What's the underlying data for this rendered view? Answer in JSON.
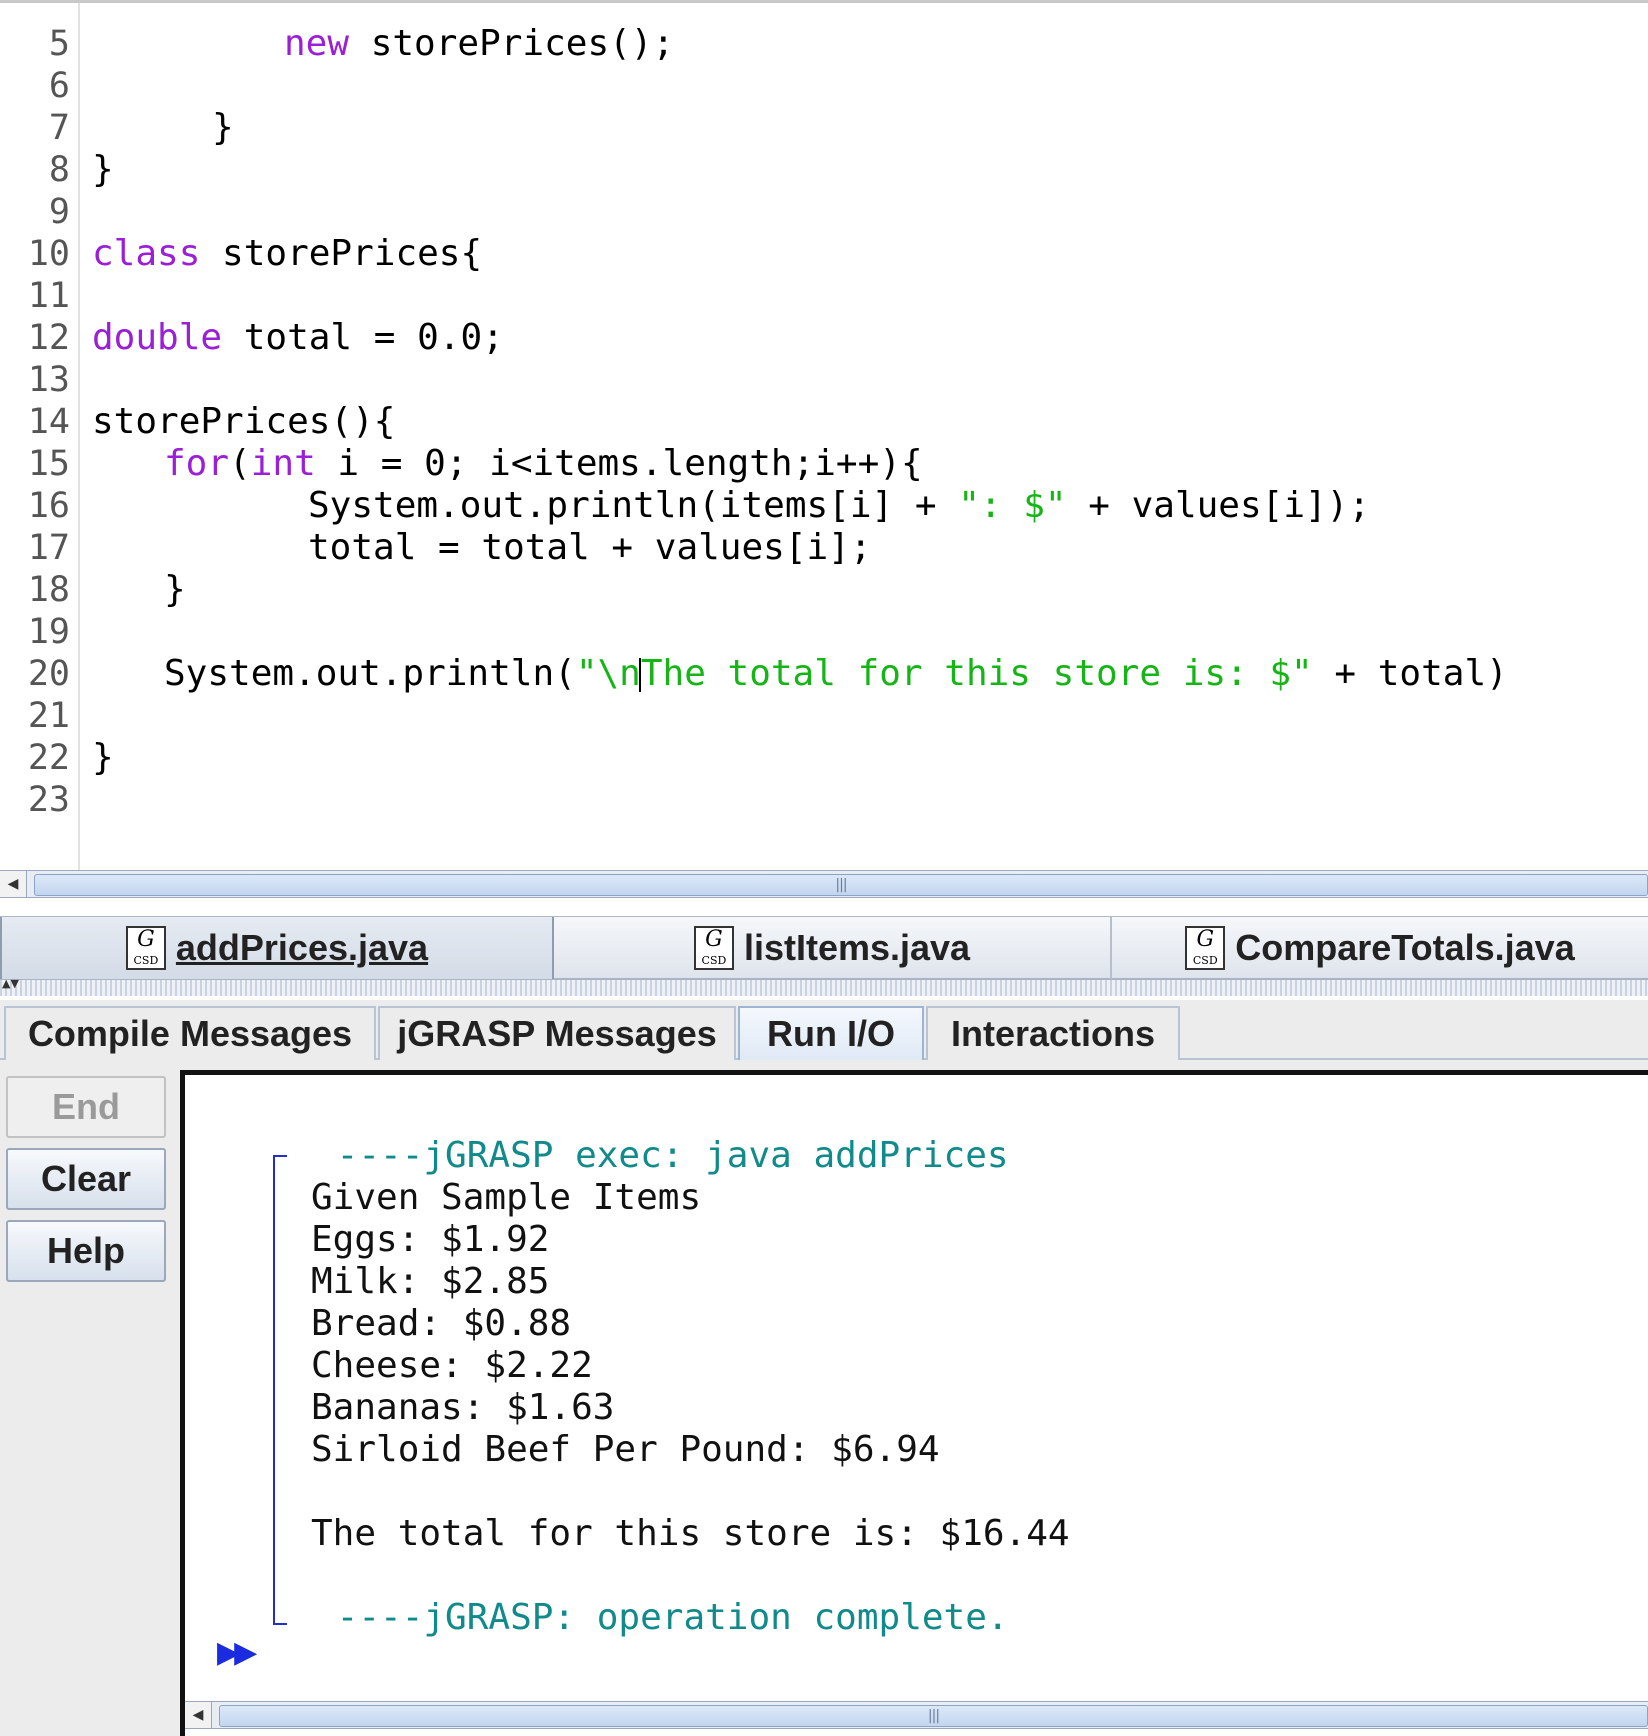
{
  "editor": {
    "line_numbers": [
      "5",
      "6",
      "7",
      "8",
      "9",
      "10",
      "11",
      "12",
      "13",
      "14",
      "15",
      "16",
      "17",
      "18",
      "19",
      "20",
      "21",
      "22",
      "23"
    ],
    "code": {
      "l5_kw": "new",
      "l5_rest": " storePrices();",
      "l7": "}",
      "l8": "}",
      "l10_kw": "class",
      "l10_rest": " storePrices{",
      "l12_kw": "double",
      "l12_rest": " total = 0.0;",
      "l14": "storePrices(){",
      "l15_kw1": "for",
      "l15_p": "(",
      "l15_kw2": "int",
      "l15_rest": " i = 0; i<items.length;i++){",
      "l16_a": "System.out.println(items[i] + ",
      "l16_str": "\": $\"",
      "l16_b": " + values[i]);",
      "l17": "total = total + values[i];",
      "l18": "}",
      "l20_a": "System.out.println(",
      "l20_str1": "\"\\n",
      "l20_str2": "The total for this store is: $\"",
      "l20_b": " + total)",
      "l22": "}"
    }
  },
  "file_tabs": [
    {
      "label": "addPrices.java",
      "icon": "gcsd-file-icon",
      "icon_g": "G",
      "icon_csd": "CSD",
      "active": true
    },
    {
      "label": "listItems.java",
      "icon": "gcsd-file-icon",
      "icon_g": "G",
      "icon_csd": "CSD",
      "active": false
    },
    {
      "label": "CompareTotals.java",
      "icon": "gcsd-file-icon",
      "icon_g": "G",
      "icon_csd": "CSD",
      "active": false
    }
  ],
  "message_tabs": [
    {
      "label": "Compile Messages",
      "active": false
    },
    {
      "label": "jGRASP Messages",
      "active": false
    },
    {
      "label": "Run I/O",
      "active": true
    },
    {
      "label": "Interactions",
      "active": false
    }
  ],
  "side_buttons": {
    "end": "End",
    "clear": "Clear",
    "help": "Help"
  },
  "console": {
    "exec_line": " ----jGRASP exec: java addPrices",
    "output": [
      "Given Sample Items",
      "Eggs: $1.92",
      "Milk: $2.85",
      "Bread: $0.88",
      "Cheese: $2.22",
      "Bananas: $1.63",
      "Sirloid Beef Per Pound: $6.94",
      "",
      "The total for this store is: $16.44"
    ],
    "complete_line": " ----jGRASP: operation complete.",
    "prompt": "▶▶"
  },
  "colors": {
    "keyword": "#9b1fd6",
    "string": "#16b516",
    "jgrasp_message": "#108a8a",
    "prompt": "#1a2be0"
  }
}
